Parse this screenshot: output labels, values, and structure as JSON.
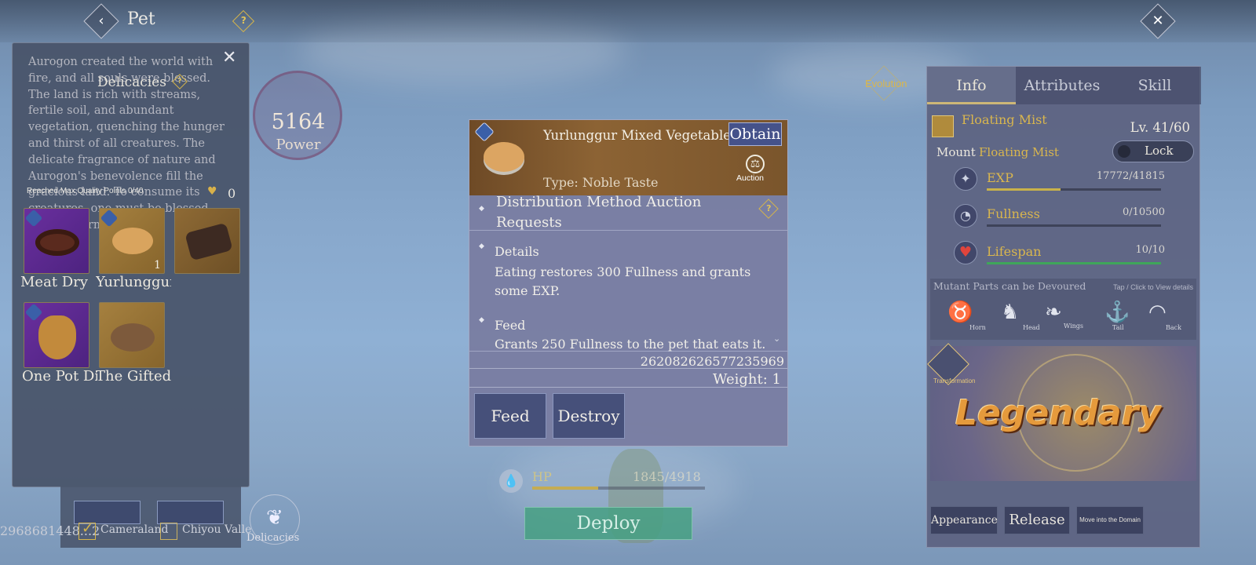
{
  "header": {
    "title": "Pet"
  },
  "left_panel": {
    "title": "Delicacies",
    "lore": "Aurogon created the world with fire, and all souls were blessed. The land is rich with streams, fertile soil, and abundant vegetation, quenching the hunger and thirst of all creatures. The delicate fragrance of nature and Aurogon's benevolence fill the gracious land. To consume its creatures, one must be blessed. Taste determines all.",
    "quality_label": "Reached Max Quality Points 0/40",
    "quality_value": "0",
    "items": [
      {
        "name": "Meat Dry",
        "count": ""
      },
      {
        "name": "Yurlunggur Mixed",
        "count": "1"
      },
      {
        "name": "",
        "count": ""
      },
      {
        "name": "One Pot Di",
        "count": ""
      },
      {
        "name": "The Gifted",
        "count": ""
      }
    ]
  },
  "power": {
    "value": "5164",
    "label": "Power"
  },
  "evolution_label": "Evolution",
  "popup": {
    "item_name": "Yurlunggur Mixed Vegetables",
    "obtain_label": "Obtain",
    "type_text": "Type: Noble Taste",
    "auction_label": "Auction",
    "distribution_title": "Distribution Method   Auction Requests",
    "details_title": "Details",
    "details_text": "Eating restores 300 Fullness and grants some EXP.",
    "feed_title": "Feed",
    "feed_text": "Grants 250 Fullness to the pet that eats it.",
    "item_id": "262082626577235969",
    "weight": "Weight: 1",
    "feed_button": "Feed",
    "destroy_button": "Destroy"
  },
  "hp": {
    "label": "HP",
    "value": "1845/4918",
    "fraction": 0.38
  },
  "deploy_button": "Deploy",
  "bottom_left": {
    "id_text": "2968681448...2",
    "region1": "Cameraland",
    "region2": "Chiyou Valle",
    "delicacies_label": "Delicacies"
  },
  "right_panel": {
    "tabs": [
      "Info",
      "Attributes",
      "Skill"
    ],
    "active_tab": "Info",
    "pet_name": "Floating Mist",
    "level": "Lv. 41/60",
    "mount_label": "Mount",
    "mount_name": "Floating Mist",
    "lock_label": "Lock",
    "stats": [
      {
        "name": "EXP",
        "value": "17772/41815",
        "fraction": 0.425,
        "color": "#c9b24a"
      },
      {
        "name": "Fullness",
        "value": "0/10500",
        "fraction": 0.0,
        "color": "#c9b24a"
      },
      {
        "name": "Lifespan",
        "value": "10/10",
        "fraction": 1.0,
        "color": "#3fa65a"
      }
    ],
    "mutant_title": "Mutant Parts can be Devoured",
    "mutant_hint": "Tap / Click to View details",
    "parts": [
      "Horn",
      "Head",
      "Wings",
      "Tail",
      "Back"
    ],
    "transform_label": "Transformation",
    "rarity": "Legendary",
    "buttons": {
      "appearance": "Appearance",
      "release": "Release",
      "domain": "Move into the Domain"
    }
  }
}
